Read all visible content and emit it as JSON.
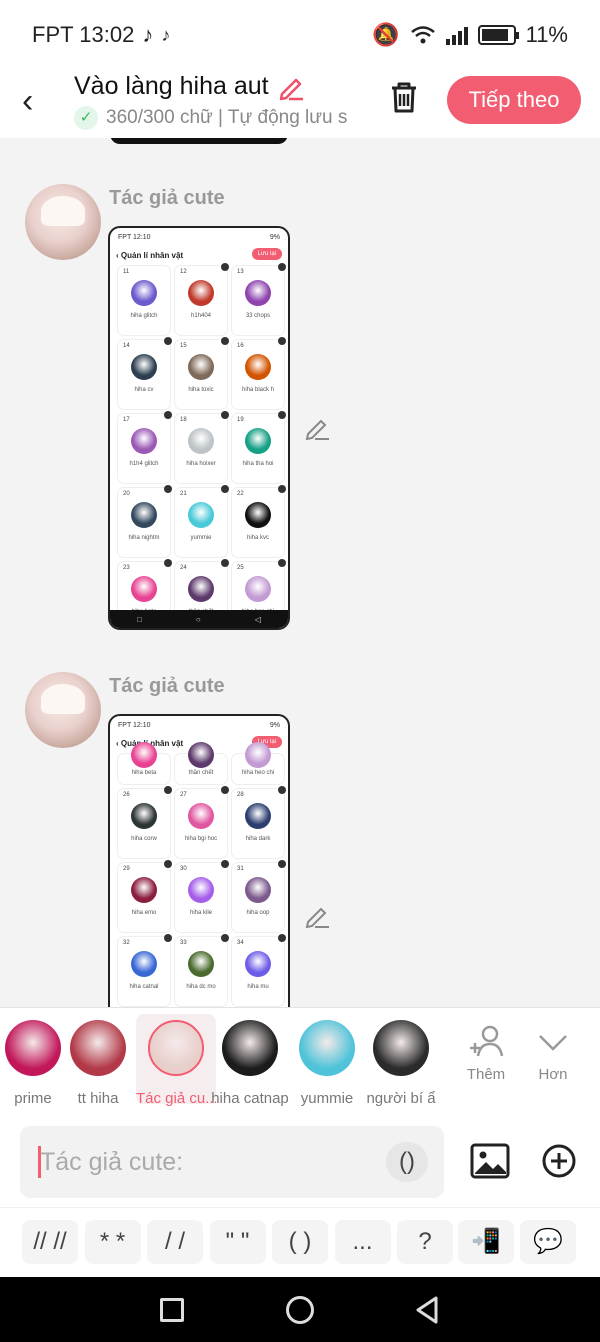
{
  "status": {
    "carrier_time": "FPT 13:02",
    "battery": "11%"
  },
  "header": {
    "title": "Vào làng hiha aut",
    "subtitle": "360/300 chữ | Tự động lưu s",
    "next_label": "Tiếp theo"
  },
  "messages": [
    {
      "author": "Tác giả cute",
      "screenshot": {
        "time": "FPT 12:10",
        "battery": "9%",
        "title": "Quản lí nhân vật",
        "save": "Lưu lại",
        "cards": [
          {
            "num": "11",
            "name": "hiha glitch",
            "color": "#6a5acd"
          },
          {
            "num": "12",
            "name": "h1h404",
            "color": "#c0392b"
          },
          {
            "num": "13",
            "name": "33 chops",
            "color": "#8e44ad"
          },
          {
            "num": "14",
            "name": "hiha cv",
            "color": "#2c3e50"
          },
          {
            "num": "15",
            "name": "hiha toxic",
            "color": "#7f6a5a"
          },
          {
            "num": "16",
            "name": "hiha black h",
            "color": "#d35400"
          },
          {
            "num": "17",
            "name": "h1h4 glitch",
            "color": "#9b59b6"
          },
          {
            "num": "18",
            "name": "hiha hoixer",
            "color": "#bdc3c7"
          },
          {
            "num": "19",
            "name": "hiha tha hoi",
            "color": "#16a085"
          },
          {
            "num": "20",
            "name": "hiha nightm",
            "color": "#34495e"
          },
          {
            "num": "21",
            "name": "yummie",
            "color": "#48c9d8"
          },
          {
            "num": "22",
            "name": "hiha kvc",
            "color": "#111111"
          },
          {
            "num": "23",
            "name": "hiha beta",
            "color": "#e84393"
          },
          {
            "num": "24",
            "name": "thần chết",
            "color": "#5d3a6b"
          },
          {
            "num": "25",
            "name": "hiha heo chi",
            "color": "#c39bd3"
          }
        ]
      }
    },
    {
      "author": "Tác giả cute",
      "screenshot": {
        "time": "FPT 12:10",
        "battery": "9%",
        "title": "Quản lí nhân vật",
        "save": "Lưu lại",
        "cards": [
          {
            "num": "",
            "name": "hiha beta",
            "color": "#e84393"
          },
          {
            "num": "",
            "name": "thần chết",
            "color": "#5d3a6b"
          },
          {
            "num": "",
            "name": "hiha heo chi",
            "color": "#c39bd3"
          },
          {
            "num": "26",
            "name": "hiha corw",
            "color": "#2d3436"
          },
          {
            "num": "27",
            "name": "hiha bgi hoc",
            "color": "#e056a0"
          },
          {
            "num": "28",
            "name": "hiha dark",
            "color": "#2c3e70"
          },
          {
            "num": "29",
            "name": "hiha emo",
            "color": "#8b1e3f"
          },
          {
            "num": "30",
            "name": "hiha kile",
            "color": "#a55eea"
          },
          {
            "num": "31",
            "name": "hiha oop",
            "color": "#7b5a8c"
          },
          {
            "num": "32",
            "name": "hiha catnal",
            "color": "#3867d6"
          },
          {
            "num": "33",
            "name": "hiha dc mo",
            "color": "#4b6a2e"
          },
          {
            "num": "34",
            "name": "hiha mu",
            "color": "#6c5ce7"
          }
        ]
      }
    }
  ],
  "characters": [
    {
      "name": "prime",
      "color": "#c2185b",
      "selected": false
    },
    {
      "name": "tt hiha",
      "color": "#b23a48",
      "selected": false
    },
    {
      "name": "Tác giả cu...",
      "color": "#e8cfcb",
      "selected": true
    },
    {
      "name": "hiha catnap",
      "color": "#1c1c1c",
      "selected": false
    },
    {
      "name": "yummie",
      "color": "#4fc3d9",
      "selected": false
    },
    {
      "name": "người bí ẩ",
      "color": "#2b2b2b",
      "selected": false
    }
  ],
  "char_tools": {
    "add_label": "Thêm",
    "more_label": "Hơn"
  },
  "input": {
    "placeholder": "Tác giả cute:",
    "paren": "()"
  },
  "symbols": [
    "// //",
    "* *",
    "/ /",
    "\" \"",
    "( )",
    "...",
    "?"
  ]
}
